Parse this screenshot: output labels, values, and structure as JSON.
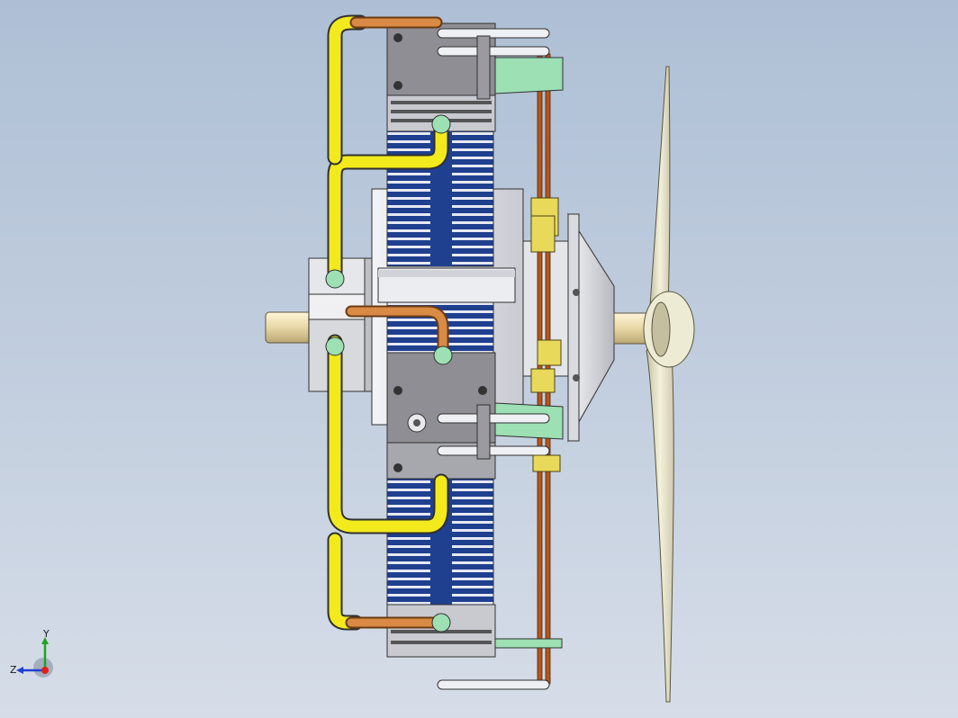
{
  "viewport": {
    "background_top": "#aebfd5",
    "background_bottom": "#d6dde8"
  },
  "model": {
    "description_visible": false,
    "colors": {
      "cylinder_fins": "#1f3f8f",
      "fuel_line": "#f2ea1c",
      "copper_line": "#d98a45",
      "push_rod": "#b5561a",
      "bracket": "#9de0b4",
      "crankcase": "#dcdde2",
      "head": "#8f8f95",
      "propeller": "#ece9d2",
      "shaft": "#efe0b0"
    }
  },
  "triad": {
    "y_label": "Y",
    "z_label": "Z",
    "x_color": "#e0201a",
    "y_color": "#1fa31f",
    "z_color": "#2040d0"
  }
}
